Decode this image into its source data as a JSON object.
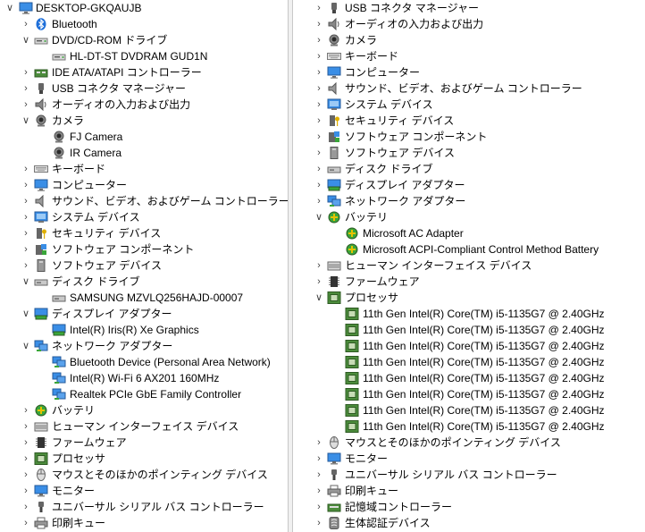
{
  "left": {
    "root": "DESKTOP-GKQAUJB",
    "items": [
      {
        "label": "Bluetooth",
        "icon": "bluetooth-icon",
        "state": "collapsed"
      },
      {
        "label": "DVD/CD-ROM ドライブ",
        "icon": "dvd-drive-icon",
        "state": "expanded",
        "children": [
          {
            "label": "HL-DT-ST DVDRAM GUD1N",
            "icon": "dvd-drive-icon"
          }
        ]
      },
      {
        "label": "IDE ATA/ATAPI コントローラー",
        "icon": "ide-controller-icon",
        "state": "collapsed"
      },
      {
        "label": "USB コネクタ マネージャー",
        "icon": "usb-connector-icon",
        "state": "collapsed"
      },
      {
        "label": "オーディオの入力および出力",
        "icon": "speaker-icon",
        "state": "collapsed"
      },
      {
        "label": "カメラ",
        "icon": "camera-icon",
        "state": "expanded",
        "children": [
          {
            "label": "FJ Camera",
            "icon": "camera-icon"
          },
          {
            "label": "IR Camera",
            "icon": "camera-icon"
          }
        ]
      },
      {
        "label": "キーボード",
        "icon": "keyboard-icon",
        "state": "collapsed"
      },
      {
        "label": "コンピューター",
        "icon": "computer-icon",
        "state": "collapsed"
      },
      {
        "label": "サウンド、ビデオ、およびゲーム コントローラー",
        "icon": "sound-icon",
        "state": "collapsed"
      },
      {
        "label": "システム デバイス",
        "icon": "system-device-icon",
        "state": "collapsed"
      },
      {
        "label": "セキュリティ デバイス",
        "icon": "security-device-icon",
        "state": "collapsed"
      },
      {
        "label": "ソフトウェア コンポーネント",
        "icon": "software-component-icon",
        "state": "collapsed"
      },
      {
        "label": "ソフトウェア デバイス",
        "icon": "software-device-icon",
        "state": "collapsed"
      },
      {
        "label": "ディスク ドライブ",
        "icon": "disk-drive-icon",
        "state": "expanded",
        "children": [
          {
            "label": "SAMSUNG MZVLQ256HAJD-00007",
            "icon": "disk-drive-icon"
          }
        ]
      },
      {
        "label": "ディスプレイ アダプター",
        "icon": "display-adapter-icon",
        "state": "expanded",
        "children": [
          {
            "label": "Intel(R) Iris(R) Xe Graphics",
            "icon": "display-adapter-icon"
          }
        ]
      },
      {
        "label": "ネットワーク アダプター",
        "icon": "network-adapter-icon",
        "state": "expanded",
        "children": [
          {
            "label": "Bluetooth Device (Personal Area Network)",
            "icon": "network-adapter-icon"
          },
          {
            "label": "Intel(R) Wi-Fi 6 AX201 160MHz",
            "icon": "network-adapter-icon"
          },
          {
            "label": "Realtek PCIe GbE Family Controller",
            "icon": "network-adapter-icon"
          }
        ]
      },
      {
        "label": "バッテリ",
        "icon": "battery-icon",
        "state": "collapsed"
      },
      {
        "label": "ヒューマン インターフェイス デバイス",
        "icon": "hid-icon",
        "state": "collapsed"
      },
      {
        "label": "ファームウェア",
        "icon": "firmware-icon",
        "state": "collapsed"
      },
      {
        "label": "プロセッサ",
        "icon": "processor-icon",
        "state": "collapsed"
      },
      {
        "label": "マウスとそのほかのポインティング デバイス",
        "icon": "mouse-icon",
        "state": "collapsed"
      },
      {
        "label": "モニター",
        "icon": "monitor-icon",
        "state": "collapsed"
      },
      {
        "label": "ユニバーサル シリアル バス コントローラー",
        "icon": "usb-icon",
        "state": "collapsed"
      },
      {
        "label": "印刷キュー",
        "icon": "printer-icon",
        "state": "collapsed"
      }
    ]
  },
  "right": {
    "items": [
      {
        "label": "USB コネクタ マネージャー",
        "icon": "usb-connector-icon",
        "state": "collapsed"
      },
      {
        "label": "オーディオの入力および出力",
        "icon": "speaker-icon",
        "state": "collapsed"
      },
      {
        "label": "カメラ",
        "icon": "camera-icon",
        "state": "collapsed"
      },
      {
        "label": "キーボード",
        "icon": "keyboard-icon",
        "state": "collapsed"
      },
      {
        "label": "コンピューター",
        "icon": "computer-icon",
        "state": "collapsed"
      },
      {
        "label": "サウンド、ビデオ、およびゲーム コントローラー",
        "icon": "sound-icon",
        "state": "collapsed"
      },
      {
        "label": "システム デバイス",
        "icon": "system-device-icon",
        "state": "collapsed"
      },
      {
        "label": "セキュリティ デバイス",
        "icon": "security-device-icon",
        "state": "collapsed"
      },
      {
        "label": "ソフトウェア コンポーネント",
        "icon": "software-component-icon",
        "state": "collapsed"
      },
      {
        "label": "ソフトウェア デバイス",
        "icon": "software-device-icon",
        "state": "collapsed"
      },
      {
        "label": "ディスク ドライブ",
        "icon": "disk-drive-icon",
        "state": "collapsed"
      },
      {
        "label": "ディスプレイ アダプター",
        "icon": "display-adapter-icon",
        "state": "collapsed"
      },
      {
        "label": "ネットワーク アダプター",
        "icon": "network-adapter-icon",
        "state": "collapsed"
      },
      {
        "label": "バッテリ",
        "icon": "battery-icon",
        "state": "expanded",
        "children": [
          {
            "label": "Microsoft AC Adapter",
            "icon": "battery-icon"
          },
          {
            "label": "Microsoft ACPI-Compliant Control Method Battery",
            "icon": "battery-icon"
          }
        ]
      },
      {
        "label": "ヒューマン インターフェイス デバイス",
        "icon": "hid-icon",
        "state": "collapsed"
      },
      {
        "label": "ファームウェア",
        "icon": "firmware-icon",
        "state": "collapsed"
      },
      {
        "label": "プロセッサ",
        "icon": "processor-icon",
        "state": "expanded",
        "children": [
          {
            "label": "11th Gen Intel(R) Core(TM) i5-1135G7 @ 2.40GHz",
            "icon": "processor-icon"
          },
          {
            "label": "11th Gen Intel(R) Core(TM) i5-1135G7 @ 2.40GHz",
            "icon": "processor-icon"
          },
          {
            "label": "11th Gen Intel(R) Core(TM) i5-1135G7 @ 2.40GHz",
            "icon": "processor-icon"
          },
          {
            "label": "11th Gen Intel(R) Core(TM) i5-1135G7 @ 2.40GHz",
            "icon": "processor-icon"
          },
          {
            "label": "11th Gen Intel(R) Core(TM) i5-1135G7 @ 2.40GHz",
            "icon": "processor-icon"
          },
          {
            "label": "11th Gen Intel(R) Core(TM) i5-1135G7 @ 2.40GHz",
            "icon": "processor-icon"
          },
          {
            "label": "11th Gen Intel(R) Core(TM) i5-1135G7 @ 2.40GHz",
            "icon": "processor-icon"
          },
          {
            "label": "11th Gen Intel(R) Core(TM) i5-1135G7 @ 2.40GHz",
            "icon": "processor-icon"
          }
        ]
      },
      {
        "label": "マウスとそのほかのポインティング デバイス",
        "icon": "mouse-icon",
        "state": "collapsed"
      },
      {
        "label": "モニター",
        "icon": "monitor-icon",
        "state": "collapsed"
      },
      {
        "label": "ユニバーサル シリアル バス コントローラー",
        "icon": "usb-icon",
        "state": "collapsed"
      },
      {
        "label": "印刷キュー",
        "icon": "printer-icon",
        "state": "collapsed"
      },
      {
        "label": "記憶域コントローラー",
        "icon": "storage-controller-icon",
        "state": "collapsed"
      },
      {
        "label": "生体認証デバイス",
        "icon": "biometric-icon",
        "state": "collapsed"
      }
    ]
  }
}
